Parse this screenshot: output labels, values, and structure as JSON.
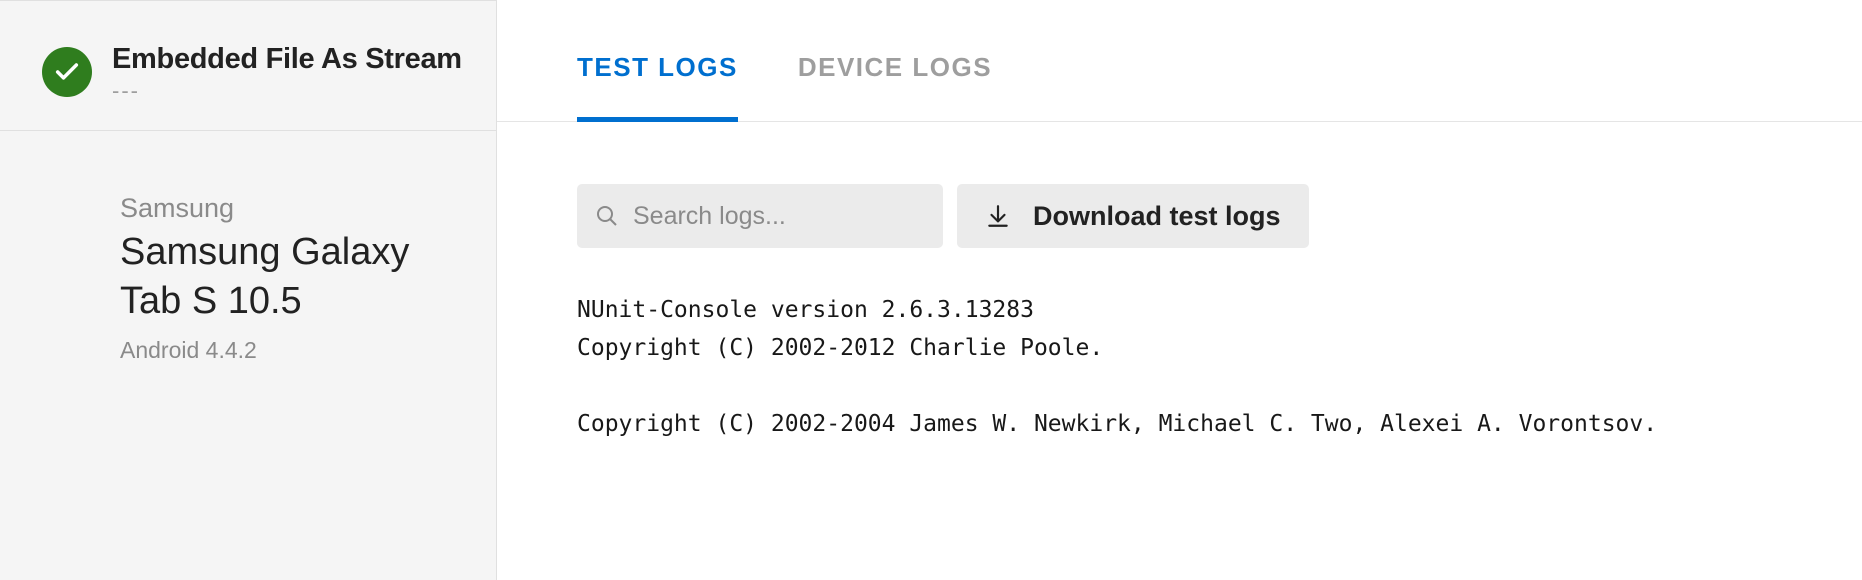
{
  "sidebar": {
    "status": "passed",
    "title": "Embedded File As Stream",
    "subtitle": "---",
    "device": {
      "vendor": "Samsung",
      "name": "Samsung Galaxy Tab S 10.5",
      "os": "Android 4.4.2"
    }
  },
  "tabs": [
    {
      "label": "TEST LOGS",
      "active": true
    },
    {
      "label": "DEVICE LOGS",
      "active": false
    }
  ],
  "toolbar": {
    "search_placeholder": "Search logs...",
    "download_label": "Download test logs"
  },
  "logs": "NUnit-Console version 2.6.3.13283\nCopyright (C) 2002-2012 Charlie Poole.\n\nCopyright (C) 2002-2004 James W. Newkirk, Michael C. Two, Alexei A. Vorontsov."
}
